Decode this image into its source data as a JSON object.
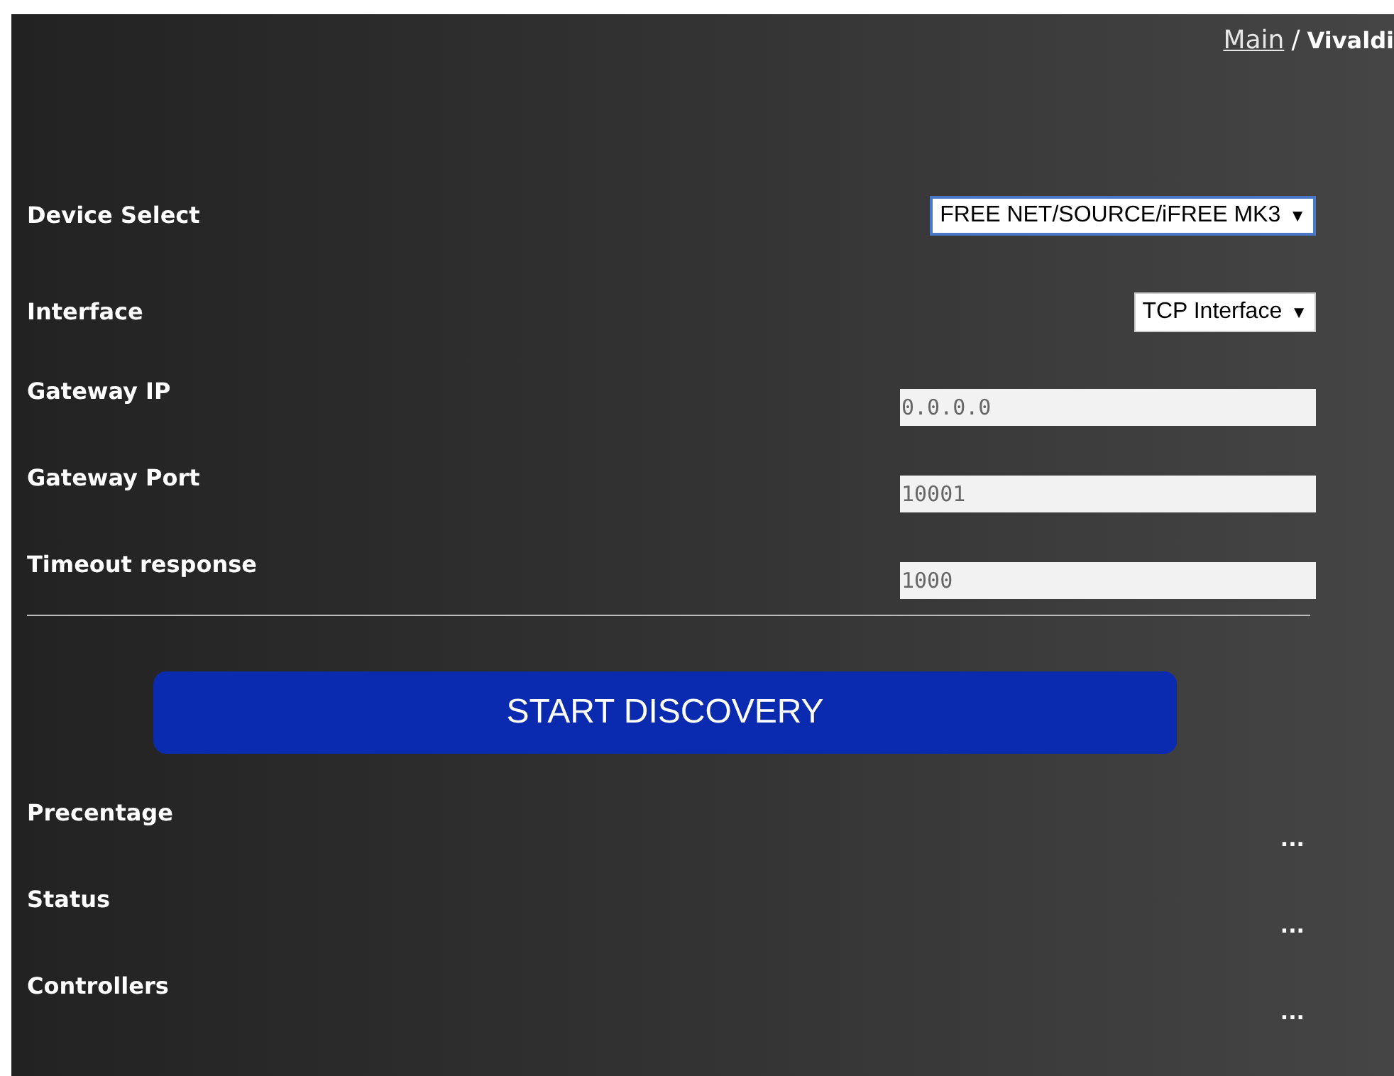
{
  "breadcrumb": {
    "link": "Main",
    "separator": "/",
    "current": "Vivaldi"
  },
  "selects": [
    {
      "label": "Device Select",
      "value": "FREE NET/SOURCE/iFREE MK3",
      "arrow": "▼",
      "focused": true
    },
    {
      "label": "Interface",
      "value": "TCP Interface",
      "arrow": "▼",
      "focused": false
    }
  ],
  "fields": [
    {
      "label": "Gateway IP",
      "value": "0.0.0.0"
    },
    {
      "label": "Gateway Port",
      "value": "10001"
    },
    {
      "label": "Timeout response",
      "value": "1000"
    }
  ],
  "button": "START DISCOVERY",
  "results": [
    {
      "label": "Precentage",
      "value": "..."
    },
    {
      "label": "Status",
      "value": "..."
    },
    {
      "label": "Controllers",
      "value": "..."
    }
  ]
}
